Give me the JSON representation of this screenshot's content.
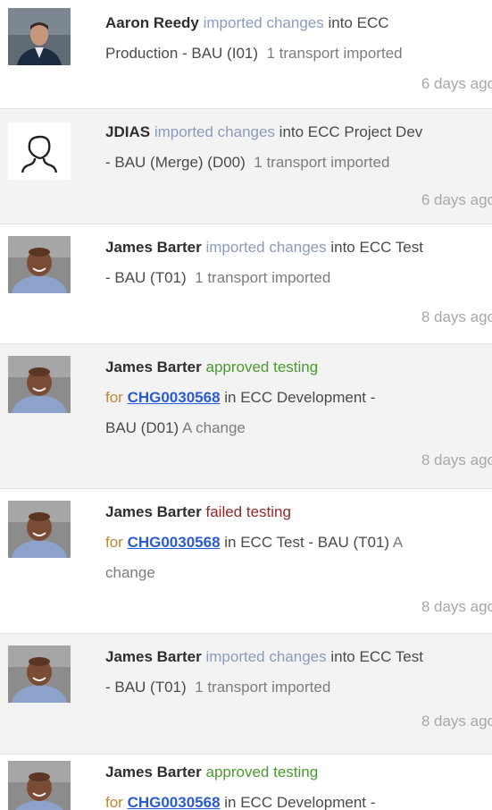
{
  "feed": {
    "items": [
      {
        "user": "Aaron Reedy",
        "verb": "imported changes",
        "line1_rest": " into ECC",
        "line2": "Production - BAU (I01)",
        "detail": "1 transport imported",
        "time": "6 days ago"
      },
      {
        "user": "JDIAS",
        "verb": "imported changes",
        "line1_rest": " into ECC Project Dev",
        "line2": "- BAU (Merge) (D00)",
        "detail": "1 transport imported",
        "time": "6 days ago"
      },
      {
        "user": "James Barter",
        "verb": "imported changes",
        "line1_rest": " into ECC Test",
        "line2": "- BAU (T01)",
        "detail": "1 transport imported",
        "time": "8 days ago"
      },
      {
        "user": "James Barter",
        "verb": "approved testing",
        "for": "for ",
        "change": "CHG0030568",
        "line2_rest": " in ECC Development -",
        "line3": "BAU (D01)",
        "detail": "A change",
        "time": "8 days ago"
      },
      {
        "user": "James Barter",
        "verb": "failed testing",
        "for": "for ",
        "change": "CHG0030568",
        "line2_rest": " in ECC Test - BAU (T01)",
        "detail": "A",
        "line3": "change",
        "time": "8 days ago"
      },
      {
        "user": "James Barter",
        "verb": "imported changes",
        "line1_rest": " into ECC Test",
        "line2": "- BAU (T01)",
        "detail": "1 transport imported",
        "time": "8 days ago"
      },
      {
        "user": "James Barter",
        "verb": "approved testing",
        "for": "for ",
        "change": "CHG0030568",
        "line2_rest": " in ECC Development -"
      }
    ]
  }
}
